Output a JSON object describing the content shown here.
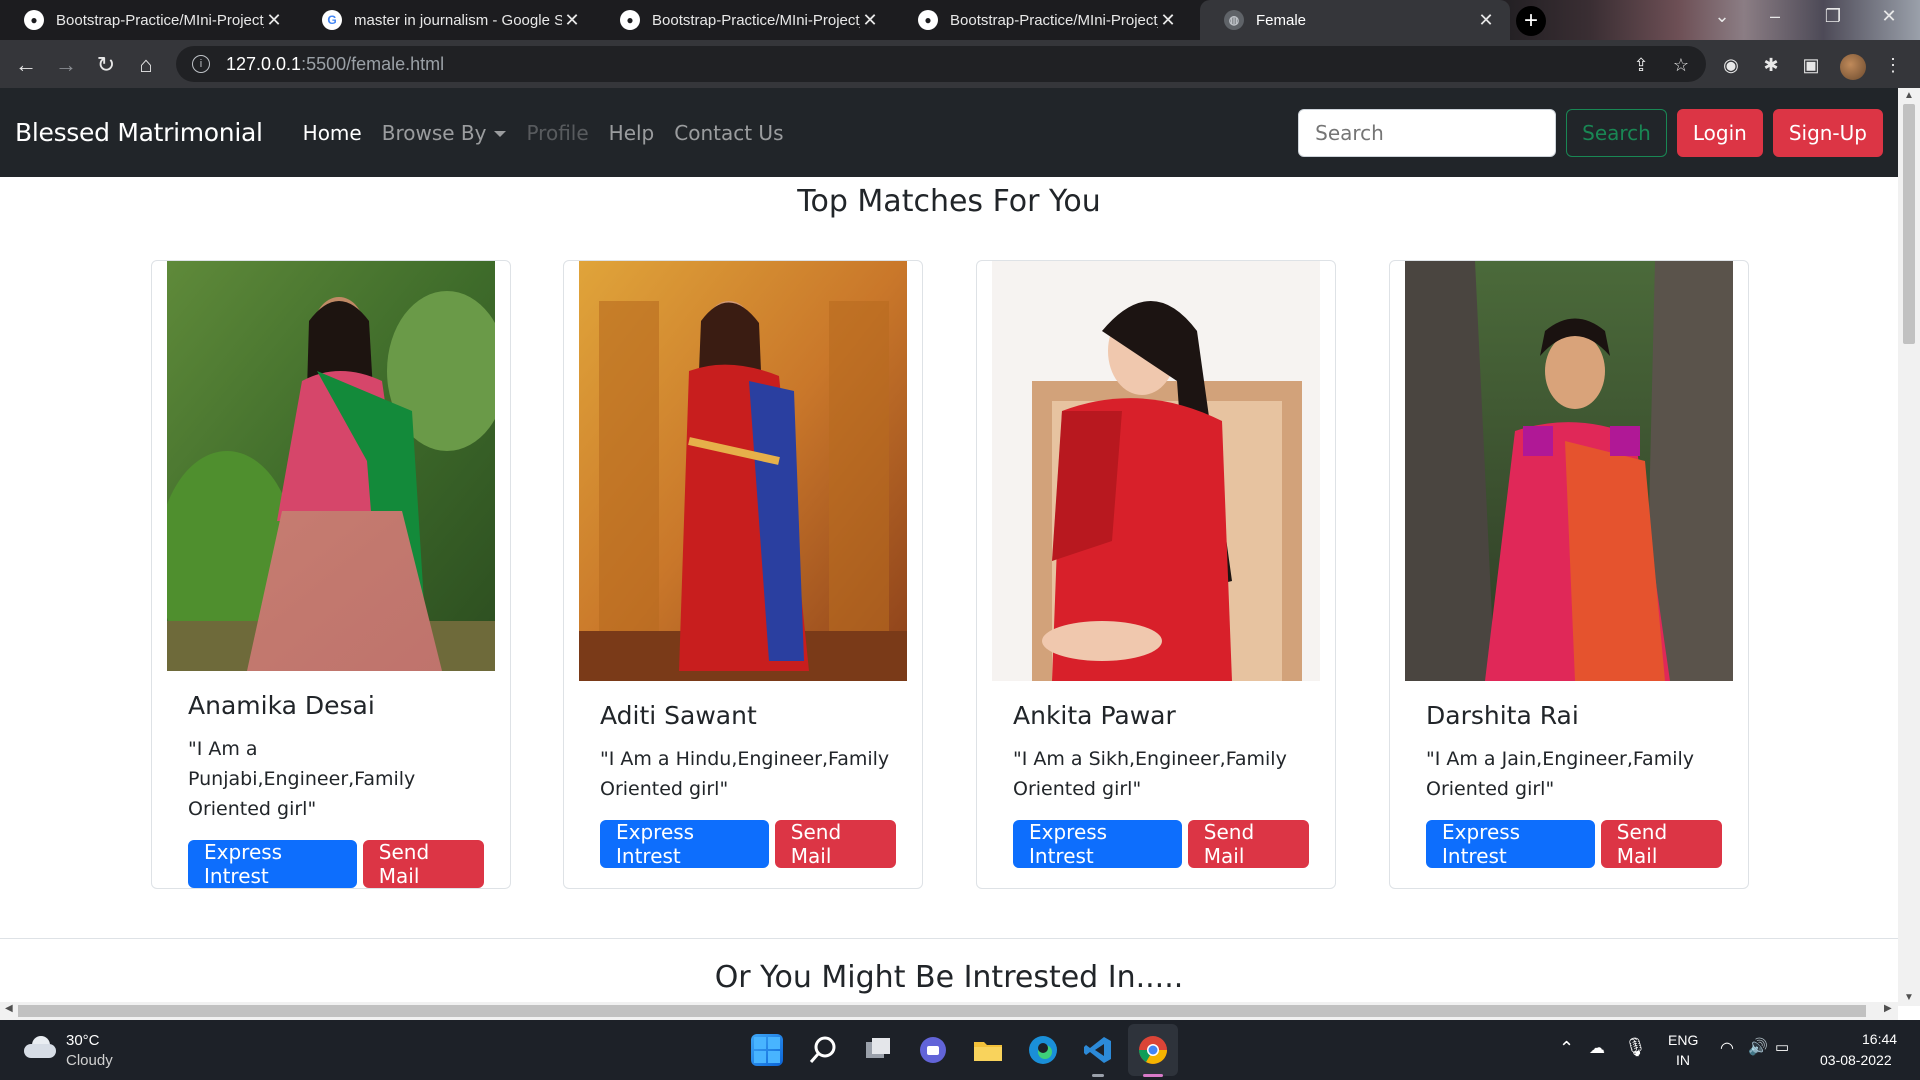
{
  "browser": {
    "tabs": [
      {
        "title": "Bootstrap-Practice/MIni-Project_",
        "icon": "github-icon",
        "active": false
      },
      {
        "title": "master in journalism - Google Se",
        "icon": "google-icon",
        "active": false
      },
      {
        "title": "Bootstrap-Practice/MIni-Project_",
        "icon": "github-icon",
        "active": false
      },
      {
        "title": "Bootstrap-Practice/MIni-Project_",
        "icon": "github-icon",
        "active": false
      },
      {
        "title": "Female",
        "icon": "globe-icon",
        "active": true
      }
    ],
    "url_host": "127.0.0.1",
    "url_rest": ":5500/female.html"
  },
  "navbar": {
    "brand": "Blessed Matrimonial",
    "links": {
      "home": "Home",
      "browse": "Browse By",
      "profile": "Profile",
      "help": "Help",
      "contact": "Contact Us"
    },
    "search_placeholder": "Search",
    "search_button": "Search",
    "login": "Login",
    "signup": "Sign-Up"
  },
  "sections": {
    "top_title": "Top Matches For You",
    "bottom_title": "Or You Might Be Intrested In....."
  },
  "cards": [
    {
      "name": "Anamika Desai",
      "text": "\"I Am a Punjabi,Engineer,Family Oriented girl\"",
      "express": "Express Intrest",
      "mail": "Send Mail"
    },
    {
      "name": "Aditi Sawant",
      "text": "\"I Am a Hindu,Engineer,Family Oriented girl\"",
      "express": "Express Intrest",
      "mail": "Send Mail"
    },
    {
      "name": "Ankita Pawar",
      "text": "\"I Am a Sikh,Engineer,Family Oriented girl\"",
      "express": "Express Intrest",
      "mail": "Send Mail"
    },
    {
      "name": "Darshita Rai",
      "text": "\"I Am a Jain,Engineer,Family Oriented girl\"",
      "express": "Express Intrest",
      "mail": "Send Mail"
    }
  ],
  "taskbar": {
    "temperature": "30°C",
    "weather": "Cloudy",
    "language_top": "ENG",
    "language_bottom": "IN",
    "time": "16:44",
    "date": "03-08-2022"
  },
  "colors": {
    "navbar_bg": "#212529",
    "primary": "#0d6efd",
    "danger": "#dc3545",
    "success": "#198754"
  }
}
